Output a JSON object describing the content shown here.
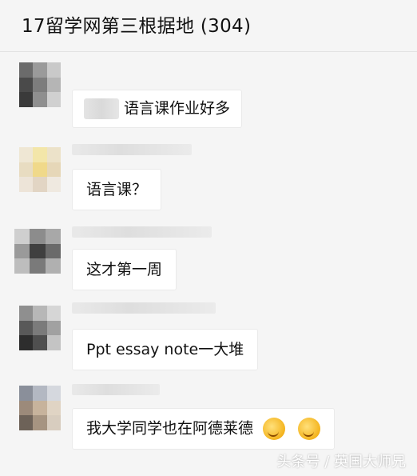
{
  "header": {
    "title": "17留学网第三根据地 (304)"
  },
  "messages": [
    {
      "text": "语言课作业好多"
    },
    {
      "text": "语言课？"
    },
    {
      "text": "这才第一周"
    },
    {
      "text": "Ppt essay note一大堆"
    },
    {
      "text": "我大学同学也在阿德莱德",
      "emoji": "thinking-face-icon"
    }
  ],
  "watermark": {
    "text": "头条号 / 英国大师兄"
  }
}
